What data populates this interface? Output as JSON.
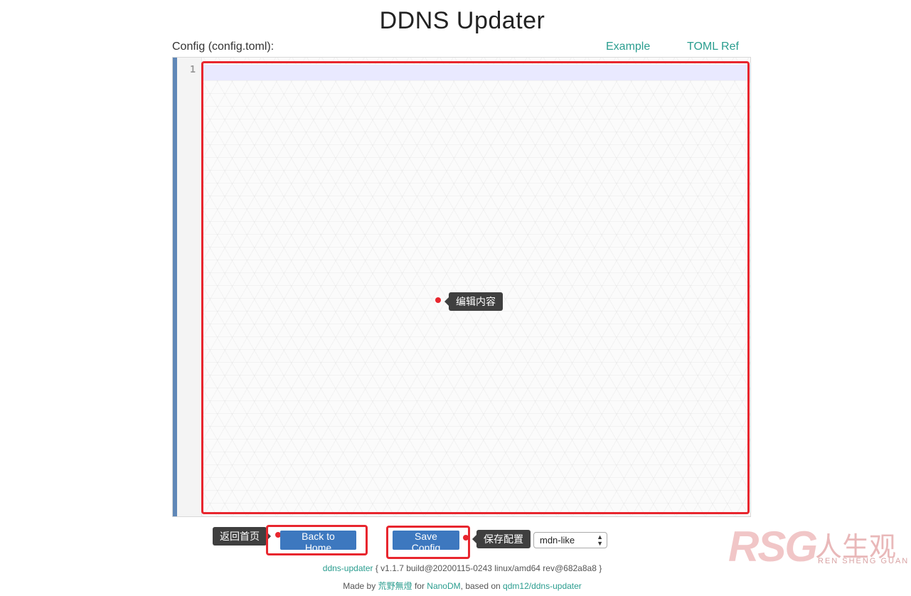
{
  "header": {
    "title": "DDNS Updater",
    "config_label": "Config (config.toml):",
    "links": {
      "example": "Example",
      "toml_ref": "TOML Ref"
    }
  },
  "editor": {
    "line_numbers": [
      "1"
    ],
    "content": "",
    "annotation_tip": "编辑内容"
  },
  "actions": {
    "back_home_label": "Back to Home",
    "back_home_tip": "返回首页",
    "save_label": "Save Config",
    "save_tip": "保存配置",
    "theme_select_value": "mdn-like"
  },
  "footer": {
    "app_link": "ddns-updater",
    "version_text": "{ v1.1.7 build@20200115-0243 linux/amd64 rev@682a8a8 }",
    "made_by_prefix": "Made by",
    "author_link": "荒野無燈",
    "for_text": "for",
    "nanodm_link": "NanoDM",
    "based_on_text": ", based on",
    "upstream_link": "qdm12/ddns-updater"
  },
  "watermark": {
    "logo_text": "RSG",
    "cn_text": "人生观",
    "en_text": "REN SHENG GUAN"
  },
  "colors": {
    "link": "#2a9d8f",
    "button": "#3d78bf",
    "annotation_red": "#e8262e",
    "editor_leftbar": "#5f87b7",
    "active_line": "#e9e9ff",
    "tooltip_bg": "#3f3f3f"
  }
}
